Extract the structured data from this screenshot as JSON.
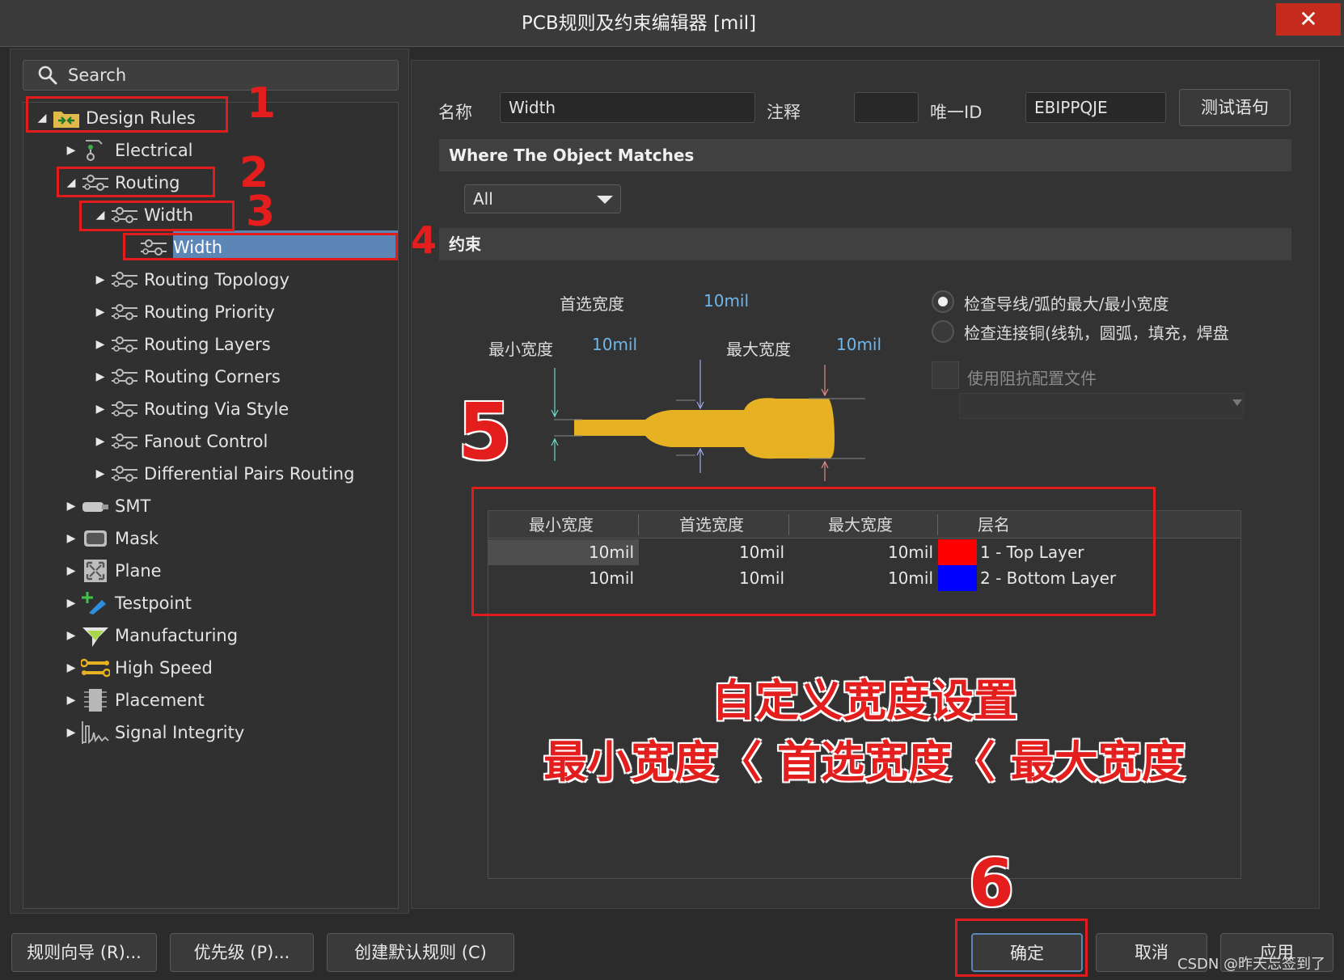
{
  "window": {
    "title": "PCB规则及约束编辑器 [mil]",
    "close_glyph": "✕"
  },
  "search": {
    "placeholder": "Search"
  },
  "tree": {
    "items": [
      {
        "label": "Design Rules",
        "expander": "◢",
        "level": 0,
        "icon": "folder-rules-icon"
      },
      {
        "label": "Electrical",
        "expander": "▶",
        "level": 1,
        "icon": "electrical-icon"
      },
      {
        "label": "Routing",
        "expander": "◢",
        "level": 1,
        "icon": "routing-icon"
      },
      {
        "label": "Width",
        "expander": "◢",
        "level": 2,
        "icon": "routing-icon"
      },
      {
        "label": "Width",
        "expander": "",
        "level": 3,
        "icon": "routing-icon",
        "selected": true
      },
      {
        "label": "Routing Topology",
        "expander": "▶",
        "level": 2,
        "icon": "routing-icon"
      },
      {
        "label": "Routing Priority",
        "expander": "▶",
        "level": 2,
        "icon": "routing-icon"
      },
      {
        "label": "Routing Layers",
        "expander": "▶",
        "level": 2,
        "icon": "routing-icon"
      },
      {
        "label": "Routing Corners",
        "expander": "▶",
        "level": 2,
        "icon": "routing-icon"
      },
      {
        "label": "Routing Via Style",
        "expander": "▶",
        "level": 2,
        "icon": "routing-icon"
      },
      {
        "label": "Fanout Control",
        "expander": "▶",
        "level": 2,
        "icon": "routing-icon"
      },
      {
        "label": "Differential Pairs Routing",
        "expander": "▶",
        "level": 2,
        "icon": "routing-icon"
      },
      {
        "label": "SMT",
        "expander": "▶",
        "level": 1,
        "icon": "smt-icon"
      },
      {
        "label": "Mask",
        "expander": "▶",
        "level": 1,
        "icon": "mask-icon"
      },
      {
        "label": "Plane",
        "expander": "▶",
        "level": 1,
        "icon": "plane-icon"
      },
      {
        "label": "Testpoint",
        "expander": "▶",
        "level": 1,
        "icon": "testpoint-icon"
      },
      {
        "label": "Manufacturing",
        "expander": "▶",
        "level": 1,
        "icon": "manufacturing-icon"
      },
      {
        "label": "High Speed",
        "expander": "▶",
        "level": 1,
        "icon": "high-speed-icon"
      },
      {
        "label": "Placement",
        "expander": "▶",
        "level": 1,
        "icon": "placement-icon"
      },
      {
        "label": "Signal Integrity",
        "expander": "▶",
        "level": 1,
        "icon": "signal-integrity-icon"
      }
    ]
  },
  "rule": {
    "name_label": "名称",
    "name_value": "Width",
    "comment_label": "注释",
    "comment_value": "",
    "uid_label": "唯一ID",
    "uid_value": "EBIPPQJE",
    "test_button": "测试语句"
  },
  "match": {
    "section_title": "Where The Object Matches",
    "selected": "All"
  },
  "constraints": {
    "section_title": "约束",
    "preferred_label": "首选宽度",
    "preferred_value": "10mil",
    "min_label": "最小宽度",
    "min_value": "10mil",
    "max_label": "最大宽度",
    "max_value": "10mil",
    "radio_1": "检查导线/弧的最大/最小宽度",
    "radio_2": "检查连接铜(线轨，圆弧，填充，焊盘",
    "radio_1_selected": true,
    "impedance_label": "使用阻抗配置文件",
    "trace_color": "#e6b122"
  },
  "table": {
    "headers": [
      "最小宽度",
      "首选宽度",
      "最大宽度",
      "层名"
    ],
    "rows": [
      {
        "min": "10mil",
        "pref": "10mil",
        "max": "10mil",
        "color": "#ff0000",
        "layer": "1 - Top Layer"
      },
      {
        "min": "10mil",
        "pref": "10mil",
        "max": "10mil",
        "color": "#0000ff",
        "layer": "2 - Bottom Layer"
      }
    ]
  },
  "annotations": {
    "n1": "1",
    "n2": "2",
    "n3": "3",
    "n4": "4",
    "n5": "5",
    "n6": "6",
    "line1": "自定义宽度设置",
    "line2": "最小宽度〈 首选宽度〈 最大宽度",
    "color": "#e21b1b"
  },
  "footer": {
    "wizard": "规则向导 (R)...",
    "priority": "优先级 (P)...",
    "create_default": "创建默认规则 (C)",
    "ok": "确定",
    "cancel": "取消",
    "apply": "应用"
  },
  "watermark": "CSDN @昨天忘签到了"
}
